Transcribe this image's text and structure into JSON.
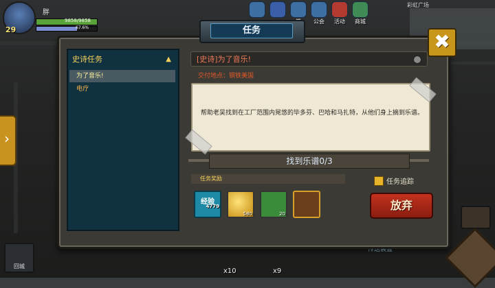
{
  "player": {
    "level": "29",
    "name": "胖",
    "hp_text": "9858/9858",
    "mp_text": "67.6%",
    "hp_fraction": 1.0,
    "mp_fraction": 0.676
  },
  "top_menu": [
    {
      "label": "",
      "icon": "guide-icon"
    },
    {
      "label": "",
      "icon": "gift-icon"
    },
    {
      "label": "常",
      "icon": "help-icon"
    },
    {
      "label": "公会",
      "icon": "guild-icon"
    },
    {
      "label": "活动",
      "icon": "activity-icon"
    },
    {
      "label": "商城",
      "icon": "shop-icon"
    }
  ],
  "minimap": {
    "label": "彩虹广场"
  },
  "window": {
    "title": "任务",
    "close_icon": "close-icon"
  },
  "quest_list": {
    "category": "史诗任务",
    "items": [
      {
        "label": "为了音乐!",
        "selected": true
      },
      {
        "label": "电疗",
        "selected": false
      }
    ]
  },
  "quest_detail": {
    "title": "[史诗]为了音乐!",
    "destination": "交付地点：钢铁美国",
    "description": "帮助老吴找到在工厂范围内晃悠的毕多芬、巴哈和马扎特，从他们身上摘到乐谱。",
    "objective": "找到乐谱0/3",
    "reward_label": "任务奖励",
    "track_label": "任务追踪",
    "track_checked": true,
    "abandon_label": "放弃",
    "rewards": [
      {
        "name": "经验",
        "count": "4779",
        "icon": "exp-icon"
      },
      {
        "name": "",
        "count": "580",
        "icon": "gold-coins-icon"
      },
      {
        "name": "",
        "count": "20",
        "icon": "wrench-icon"
      },
      {
        "name": "",
        "count": "",
        "icon": "scroll-icon"
      }
    ]
  },
  "hud": {
    "back_label": "回城",
    "teleport_label": "传送装置",
    "count_a": "x10",
    "count_b": "x9"
  },
  "colors": {
    "gold": "#c8961b",
    "abandon": "#c2321d",
    "list_bg": "#0f3140",
    "quest_title": "#f07a5a"
  }
}
